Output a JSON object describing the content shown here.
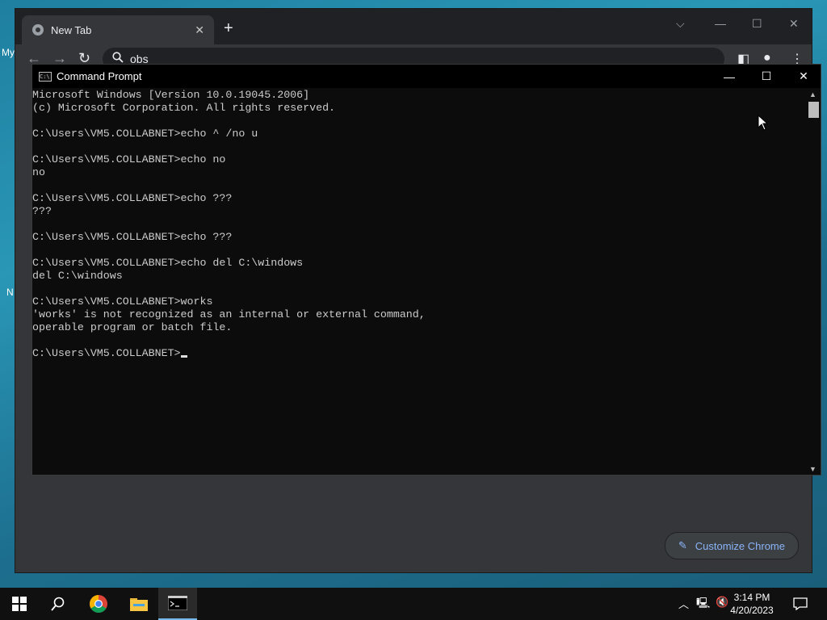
{
  "desktop": {
    "icon_labels": [
      "My",
      "N"
    ]
  },
  "chrome": {
    "tab_title": "New Tab",
    "omnibox_text": "obs",
    "customize_label": "Customize Chrome"
  },
  "cmd": {
    "title": "Command Prompt",
    "lines": [
      "Microsoft Windows [Version 10.0.19045.2006]",
      "(c) Microsoft Corporation. All rights reserved.",
      "",
      "C:\\Users\\VM5.COLLABNET>echo ^ /no u",
      "",
      "C:\\Users\\VM5.COLLABNET>echo no",
      "no",
      "",
      "C:\\Users\\VM5.COLLABNET>echo ???",
      "???",
      "",
      "C:\\Users\\VM5.COLLABNET>echo ???",
      "",
      "C:\\Users\\VM5.COLLABNET>echo del C:\\windows",
      "del C:\\windows",
      "",
      "C:\\Users\\VM5.COLLABNET>works",
      "'works' is not recognized as an internal or external command,",
      "operable program or batch file.",
      "",
      "C:\\Users\\VM5.COLLABNET>"
    ]
  },
  "taskbar": {
    "time": "3:14 PM",
    "date": "4/20/2023",
    "pinned_icons": [
      "start-icon",
      "search-icon",
      "chrome-icon",
      "file-explorer-icon",
      "command-prompt-icon"
    ]
  }
}
